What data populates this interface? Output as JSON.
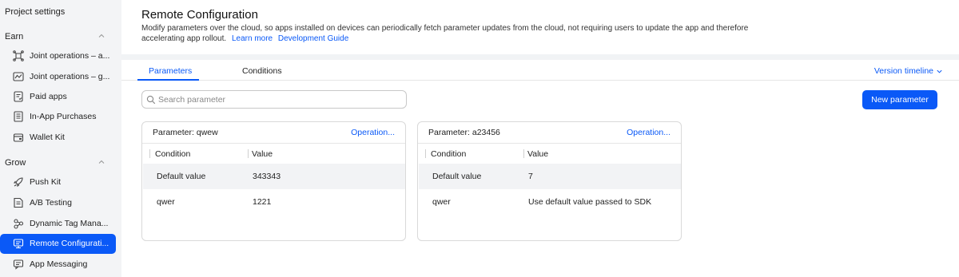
{
  "sidebar": {
    "project_settings": "Project settings",
    "groups": [
      {
        "title": "Earn"
      },
      {
        "title": "Grow"
      }
    ],
    "earn_items": [
      {
        "label": "Joint operations – a...",
        "icon": "joint-operations-icon"
      },
      {
        "label": "Joint operations – g...",
        "icon": "activity-chart-icon"
      },
      {
        "label": "Paid apps",
        "icon": "paid-apps-icon"
      },
      {
        "label": "In-App Purchases",
        "icon": "in-app-purchases-icon"
      },
      {
        "label": "Wallet Kit",
        "icon": "wallet-icon"
      }
    ],
    "grow_items": [
      {
        "label": "Push Kit",
        "icon": "push-rocket-icon"
      },
      {
        "label": "A/B Testing",
        "icon": "ab-testing-icon"
      },
      {
        "label": "Dynamic Tag Mana...",
        "icon": "dynamic-tag-icon"
      },
      {
        "label": "Remote Configurati...",
        "icon": "remote-config-icon",
        "active": true
      },
      {
        "label": "App Messaging",
        "icon": "app-messaging-icon"
      }
    ]
  },
  "header": {
    "title": "Remote Configuration",
    "description": "Modify parameters over the cloud, so apps installed on devices can periodically fetch parameter updates from the cloud, not requiring users to update the app and therefore accelerating app rollout.",
    "learn_more": "Learn more",
    "dev_guide": "Development Guide"
  },
  "tabs": [
    {
      "label": "Parameters",
      "active": true
    },
    {
      "label": "Conditions",
      "active": false
    }
  ],
  "version_timeline": "Version timeline",
  "search": {
    "placeholder": "Search parameter",
    "value": ""
  },
  "new_parameter": "New parameter",
  "columns": {
    "condition": "Condition",
    "value": "Value"
  },
  "cards": [
    {
      "name": "Parameter: qwew",
      "operation": "Operation...",
      "rows": [
        {
          "condition": "Default value",
          "value": "343343"
        },
        {
          "condition": "qwer",
          "value": "1221"
        }
      ]
    },
    {
      "name": "Parameter: a23456",
      "operation": "Operation...",
      "rows": [
        {
          "condition": "Default value",
          "value": "7"
        },
        {
          "condition": "qwer",
          "value": "Use default value passed to SDK"
        }
      ]
    }
  ],
  "colors": {
    "accent": "#0a59f7",
    "sidebar_bg": "#f3f4f6"
  }
}
